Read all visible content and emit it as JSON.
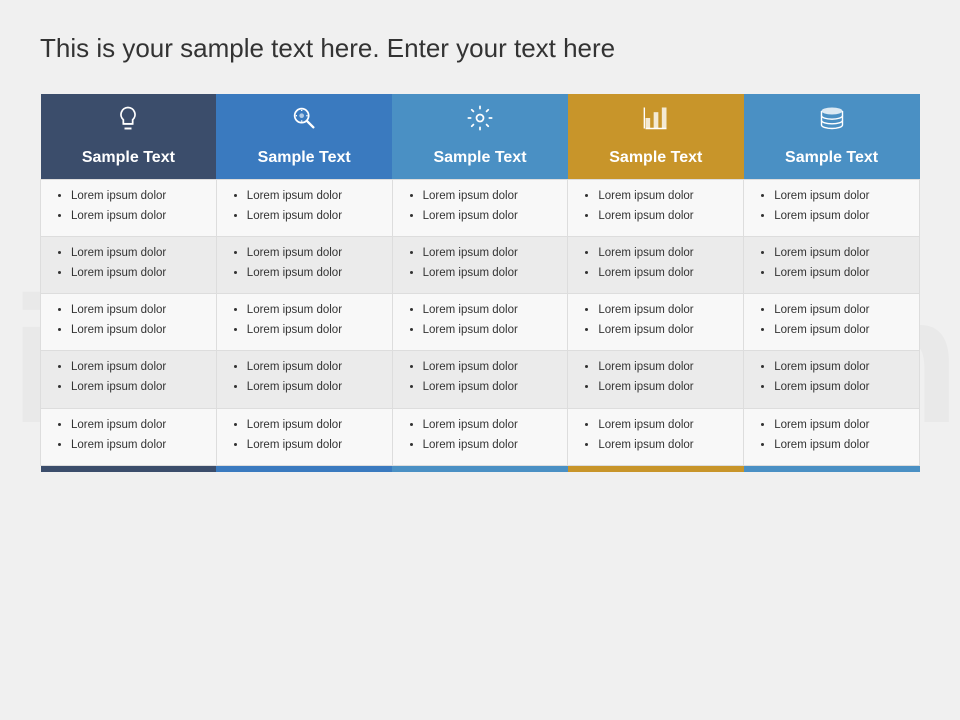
{
  "title": "This is your sample text here. Enter your text here",
  "watermark": "infoDiagram",
  "columns": [
    {
      "id": 1,
      "colorClass": "col-1",
      "icon": "lightbulb",
      "label": "Sample Text",
      "footerColor": "#3b4d6b"
    },
    {
      "id": 2,
      "colorClass": "col-2",
      "icon": "search-gear",
      "label": "Sample Text",
      "footerColor": "#3a7abf"
    },
    {
      "id": 3,
      "colorClass": "col-3",
      "icon": "gear",
      "label": "Sample Text",
      "footerColor": "#4a90c4"
    },
    {
      "id": 4,
      "colorClass": "col-4",
      "icon": "chart",
      "label": "Sample Text",
      "footerColor": "#c8952a"
    },
    {
      "id": 5,
      "colorClass": "col-5",
      "icon": "stack",
      "label": "Sample Text",
      "footerColor": "#4a90c4"
    }
  ],
  "rows": [
    {
      "cells": [
        [
          "Lorem ipsum dolor",
          "Lorem ipsum dolor"
        ],
        [
          "Lorem ipsum dolor",
          "Lorem ipsum dolor"
        ],
        [
          "Lorem ipsum dolor",
          "Lorem ipsum dolor"
        ],
        [
          "Lorem ipsum dolor",
          "Lorem ipsum dolor"
        ],
        [
          "Lorem ipsum dolor",
          "Lorem ipsum dolor"
        ]
      ]
    },
    {
      "cells": [
        [
          "Lorem ipsum dolor",
          "Lorem ipsum dolor"
        ],
        [
          "Lorem ipsum dolor",
          "Lorem ipsum dolor"
        ],
        [
          "Lorem ipsum dolor",
          "Lorem ipsum dolor"
        ],
        [
          "Lorem ipsum dolor",
          "Lorem ipsum dolor"
        ],
        [
          "Lorem ipsum dolor",
          "Lorem ipsum dolor"
        ]
      ]
    },
    {
      "cells": [
        [
          "Lorem ipsum dolor",
          "Lorem ipsum dolor"
        ],
        [
          "Lorem ipsum dolor",
          "Lorem ipsum dolor"
        ],
        [
          "Lorem ipsum dolor",
          "Lorem ipsum dolor"
        ],
        [
          "Lorem ipsum dolor",
          "Lorem ipsum dolor"
        ],
        [
          "Lorem ipsum dolor",
          "Lorem ipsum dolor"
        ]
      ]
    },
    {
      "cells": [
        [
          "Lorem ipsum dolor",
          "Lorem ipsum dolor"
        ],
        [
          "Lorem ipsum dolor",
          "Lorem ipsum dolor"
        ],
        [
          "Lorem ipsum dolor",
          "Lorem ipsum dolor"
        ],
        [
          "Lorem ipsum dolor",
          "Lorem ipsum dolor"
        ],
        [
          "Lorem ipsum dolor",
          "Lorem ipsum dolor"
        ]
      ]
    },
    {
      "cells": [
        [
          "Lorem ipsum dolor",
          "Lorem ipsum dolor"
        ],
        [
          "Lorem ipsum dolor",
          "Lorem ipsum dolor"
        ],
        [
          "Lorem ipsum dolor",
          "Lorem ipsum dolor"
        ],
        [
          "Lorem ipsum dolor",
          "Lorem ipsum dolor"
        ],
        [
          "Lorem ipsum dolor",
          "Lorem ipsum dolor"
        ]
      ]
    }
  ]
}
